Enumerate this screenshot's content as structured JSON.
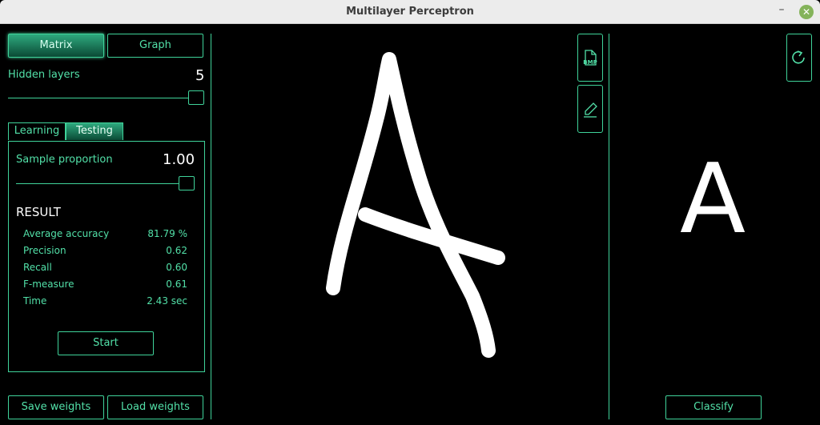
{
  "window": {
    "title": "Multilayer Perceptron"
  },
  "view_tabs": {
    "matrix": "Matrix",
    "graph": "Graph"
  },
  "hidden_layers": {
    "label": "Hidden layers",
    "value": "5"
  },
  "mode_tabs": {
    "learning": "Learning",
    "testing": "Testing"
  },
  "testing": {
    "sample_label": "Sample proportion",
    "sample_value": "1.00",
    "result_title": "RESULT",
    "stats": [
      {
        "name": "Average accuracy",
        "value": "81.79 %"
      },
      {
        "name": "Precision",
        "value": "0.62"
      },
      {
        "name": "Recall",
        "value": "0.60"
      },
      {
        "name": "F-measure",
        "value": "0.61"
      },
      {
        "name": "Time",
        "value": "2.43 sec"
      }
    ],
    "start_label": "Start"
  },
  "weights": {
    "save_label": "Save weights",
    "load_label": "Load weights"
  },
  "tools": {
    "bmp_label": "BMP"
  },
  "prediction": {
    "letter": "A",
    "classify_label": "Classify"
  },
  "colors": {
    "accent": "#3fd39a",
    "text": "#52e0a8",
    "background": "#000000"
  },
  "icons": [
    "bmp-file-icon",
    "pencil-icon",
    "refresh-icon",
    "minimize-icon",
    "close-icon"
  ]
}
